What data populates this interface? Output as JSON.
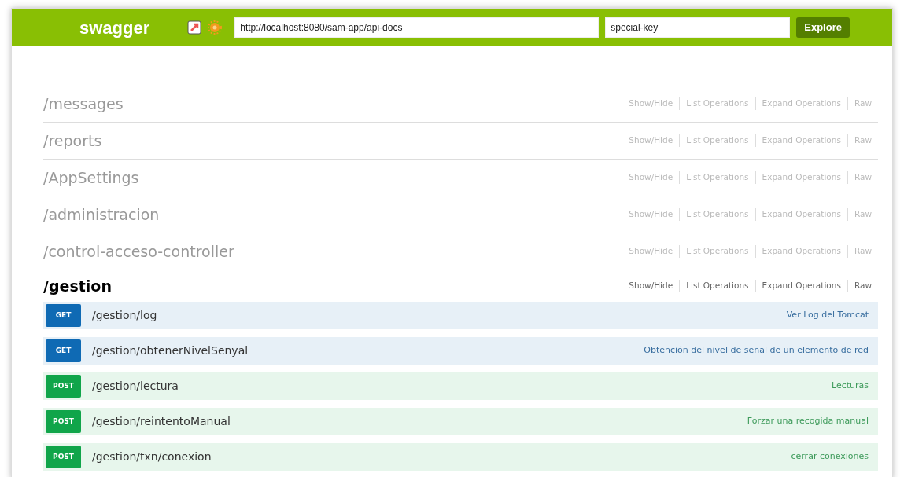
{
  "header": {
    "logo": "swagger",
    "url_field": "http://localhost:8080/sam-app/api-docs",
    "key_field": "special-key",
    "explore_button": "Explore"
  },
  "resources": [
    {
      "name": "/messages",
      "expanded": false,
      "links": [
        "Show/Hide",
        "List Operations",
        "Expand Operations",
        "Raw"
      ]
    },
    {
      "name": "/reports",
      "expanded": false,
      "links": [
        "Show/Hide",
        "List Operations",
        "Expand Operations",
        "Raw"
      ]
    },
    {
      "name": "/AppSettings",
      "expanded": false,
      "links": [
        "Show/Hide",
        "List Operations",
        "Expand Operations",
        "Raw"
      ]
    },
    {
      "name": "/administracion",
      "expanded": false,
      "links": [
        "Show/Hide",
        "List Operations",
        "Expand Operations",
        "Raw"
      ]
    },
    {
      "name": "/control-acceso-controller",
      "expanded": false,
      "links": [
        "Show/Hide",
        "List Operations",
        "Expand Operations",
        "Raw"
      ]
    },
    {
      "name": "/gestion",
      "expanded": true,
      "links": [
        "Show/Hide",
        "List Operations",
        "Expand Operations",
        "Raw"
      ],
      "operations": [
        {
          "kind": "get",
          "method": "GET",
          "path": "/gestion/log",
          "summary": "Ver Log del Tomcat"
        },
        {
          "kind": "get",
          "method": "GET",
          "path": "/gestion/obtenerNivelSenyal",
          "summary": "Obtención del nivel de señal de un elemento de red"
        },
        {
          "kind": "post",
          "method": "POST",
          "path": "/gestion/lectura",
          "summary": "Lecturas"
        },
        {
          "kind": "post",
          "method": "POST",
          "path": "/gestion/reintentoManual",
          "summary": "Forzar una recogida manual"
        },
        {
          "kind": "post",
          "method": "POST",
          "path": "/gestion/txn/conexion",
          "summary": "cerrar conexiones"
        }
      ]
    }
  ]
}
